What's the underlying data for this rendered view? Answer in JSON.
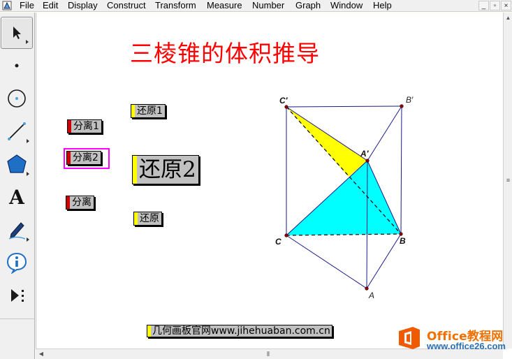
{
  "menu": {
    "items": [
      "File",
      "Edit",
      "Display",
      "Construct",
      "Transform",
      "Measure",
      "Number",
      "Graph",
      "Window",
      "Help"
    ],
    "window_buttons": [
      "_",
      "▫",
      "×"
    ]
  },
  "toolbox": {
    "tools": [
      "arrow-select-tool",
      "point-tool",
      "compass-tool",
      "straightedge-tool",
      "polygon-tool",
      "text-tool",
      "marker-tool",
      "information-tool",
      "custom-tool"
    ],
    "text_tool_glyph": "A"
  },
  "sketch": {
    "title": "三棱锥的体积推导",
    "title_color": "#ff0000",
    "buttons": {
      "separate1": "分离1",
      "restore1": "还原1",
      "separate2": "分离2",
      "restore2": "还原2",
      "separate": "分离",
      "restore": "还原"
    },
    "link_text": "几何画板官网www.jihehuaban.com.cn"
  },
  "figure": {
    "labels": {
      "C1": "C′",
      "B1": "B′",
      "A1": "A′",
      "C": "C",
      "B": "B",
      "A": "A"
    },
    "colors": {
      "yellow_face": "#ffff00",
      "cyan_face": "#00ffff",
      "edge": "#1a1a8c",
      "vertex": "#8b0000"
    }
  },
  "watermark": {
    "name": "Office教程网",
    "url": "www.office26.com"
  }
}
